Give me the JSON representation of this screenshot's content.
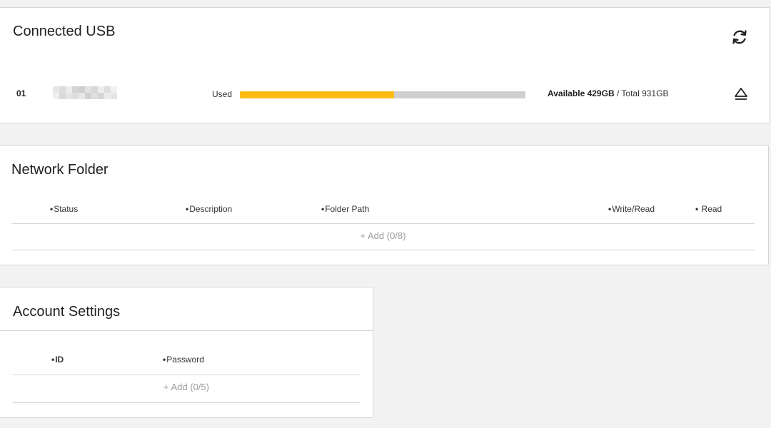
{
  "usb": {
    "title": "Connected USB",
    "devices": [
      {
        "index": "01",
        "used_label": "Used",
        "used_fraction": 0.54,
        "available_label": "Available 429GB",
        "total_label": "Total 931GB",
        "separator": " / "
      }
    ],
    "icons": {
      "refresh": "refresh-icon",
      "eject": "eject-icon"
    },
    "colors": {
      "used_fill": "#fdbb14",
      "track": "#cfcfcf"
    }
  },
  "network_folder": {
    "title": "Network Folder",
    "columns": [
      "Status",
      "Description",
      "Folder Path",
      "Write/Read",
      "Read"
    ],
    "add_label": "+ Add (0/8)"
  },
  "account_settings": {
    "title": "Account Settings",
    "columns": [
      "ID",
      "Password"
    ],
    "add_label": "+ Add (0/5)"
  }
}
